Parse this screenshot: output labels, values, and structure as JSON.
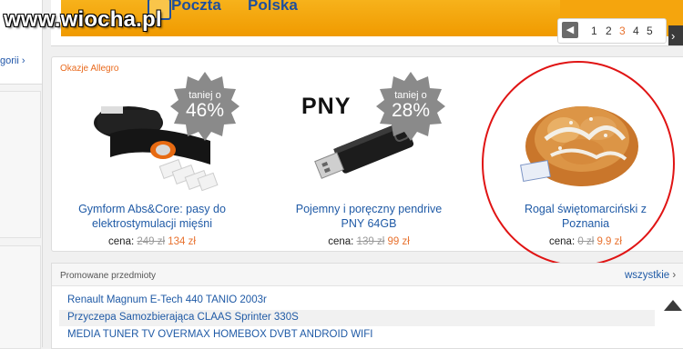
{
  "watermark": "www.wiocha.pl",
  "banner": {
    "brand_word1": "Poczta",
    "brand_word2": "Polska",
    "pager": {
      "prev_icon": "chevron-left-icon",
      "pages": [
        "1",
        "2",
        "3",
        "4",
        "5"
      ],
      "active": "3"
    },
    "edge_arrow": "›"
  },
  "sidebar": {
    "link": "gorii ›"
  },
  "offers": {
    "title": "Okazje Allegro",
    "price_label": "cena:",
    "currency": "zł",
    "products": [
      {
        "name_line1": "Gymform Abs&Core: pasy do",
        "name_line2": "elektrostymulacji mięśni",
        "old_price": "249 zł",
        "new_price": "134 zł",
        "badge_label": "taniej o",
        "badge_value": "46%",
        "image": "electrostimulation-belt"
      },
      {
        "name_line1": "Pojemny i poręczny pendrive",
        "name_line2": "PNY 64GB",
        "old_price": "139 zł",
        "new_price": "99 zł",
        "badge_label": "taniej o",
        "badge_value": "28%",
        "image": "usb-flash-drive",
        "image_text": "PNY"
      },
      {
        "name_line1": "Rogal świętomarciński z",
        "name_line2": "Poznania",
        "old_price": "0 zł",
        "new_price": "9.9 zł",
        "image": "croissant-pastry"
      }
    ]
  },
  "promoted": {
    "title": "Promowane przedmioty",
    "all_link": "wszystkie",
    "all_chevron": "›",
    "items": [
      "Renault Magnum E-Tech 440 TANIO 2003r",
      "Przyczepa Samozbierająca CLAAS Sprinter 330S",
      "MEDIA TUNER TV OVERMAX HOMEBOX DVBT ANDROID WIFI"
    ]
  },
  "colors": {
    "link": "#1f5aa6",
    "price_new": "#e8722f",
    "banner": "#f5a50d",
    "badge": "#8a8a8a",
    "highlight": "#e01414"
  }
}
